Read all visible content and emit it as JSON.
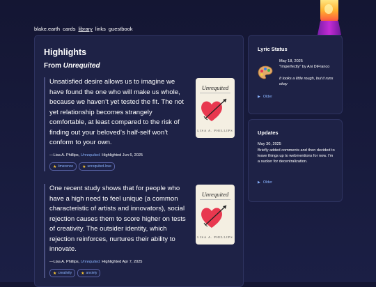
{
  "nav": {
    "items": [
      {
        "label": "blake.earth",
        "active": false
      },
      {
        "label": "cards",
        "active": false
      },
      {
        "label": "library",
        "active": true
      },
      {
        "label": "links",
        "active": false
      },
      {
        "label": "guestbook",
        "active": false
      }
    ]
  },
  "main": {
    "title": "Highlights",
    "from_label": "From",
    "book_title": "Unrequited",
    "highlights": [
      {
        "quote": "Unsatisfied desire allows us to imagine we have found the one who will make us whole, because we haven’t yet tested the fit. The not yet relationship becomes strangely comfortable, at least compared to the risk of finding out your beloved’s half-self won’t conform to your own.",
        "author": "—Lisa A. Phillips,",
        "source": "Unrequited.",
        "date": "Highlighted Jun 6, 2025",
        "tags": [
          "limerence",
          "unrequited-love"
        ]
      },
      {
        "quote": "One recent study shows that for people who have a high need to feel unique (a common characteristic of artists and innovators), social rejection causes them to score higher on tests of creativity. The outsider identity, which rejection reinforces, nurtures their ability to innovate.",
        "author": "—Lisa A. Phillips,",
        "source": "Unrequited.",
        "date": "Highlighted Apr 7, 2025",
        "tags": [
          "creativity",
          "anxiety"
        ]
      }
    ],
    "cover": {
      "title": "Unrequited",
      "author": "LISA A. PHILLIPS"
    }
  },
  "lyric": {
    "heading": "Lyric Status",
    "date": "May 18, 2025",
    "song": "\"Imperfectly\" by Ani DiFranco",
    "lyric": "It looks a little rough, but it runs okay",
    "older": "Older"
  },
  "updates": {
    "heading": "Updates",
    "date": "May 30, 2025",
    "text": "Briefly added comments and then decided to leave things up to webmentions for now. I'm a sucker for decentralization.",
    "older": "Older"
  },
  "colors": {
    "accent": "#8ab4ff",
    "background": "#1b1f45",
    "card": "#1e2246",
    "heart": "#e8384f"
  },
  "icons": {
    "tag": "star-icon",
    "lyric": "palette-icon",
    "older": "triangle-right-icon",
    "cover": "heart-arrow-icon"
  }
}
